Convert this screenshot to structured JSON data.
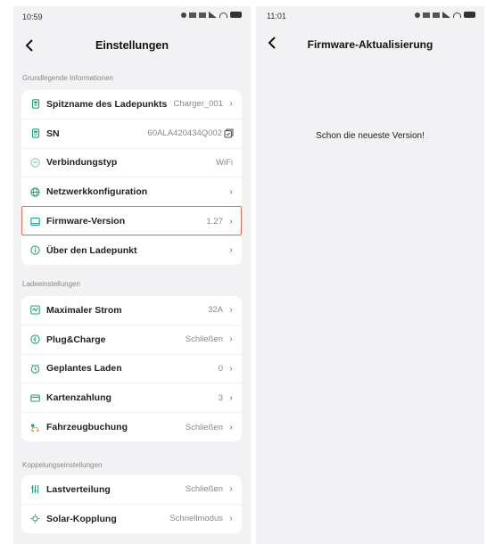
{
  "left_screen": {
    "status_time": "10:59",
    "title": "Einstellungen",
    "sections": [
      {
        "label": "Grundlegende Informationen",
        "items": [
          {
            "label": "Spitzname des Ladepunkts",
            "value": "Charger_001",
            "icon": "charger-icon",
            "control": "chevron"
          },
          {
            "label": "SN",
            "value": "60ALA420434Q002",
            "icon": "charger-icon",
            "control": "copy"
          },
          {
            "label": "Verbindungstyp",
            "value": "WiFi",
            "icon": "connection-icon",
            "control": "none"
          },
          {
            "label": "Netzwerkkonfiguration",
            "value": "",
            "icon": "globe-icon",
            "control": "chevron"
          },
          {
            "label": "Firmware-Version",
            "value": "1.27",
            "icon": "firmware-icon",
            "control": "chevron",
            "highlighted": true
          },
          {
            "label": "Über den Ladepunkt",
            "value": "",
            "icon": "info-icon",
            "control": "chevron"
          }
        ]
      },
      {
        "label": "Ladeeinstellungen",
        "items": [
          {
            "label": "Maximaler Strom",
            "value": "32A",
            "icon": "current-icon",
            "control": "chevron"
          },
          {
            "label": "Plug&Charge",
            "value": "Schließen",
            "icon": "plug-charge-icon",
            "control": "chevron"
          },
          {
            "label": "Geplantes Laden",
            "value": "0",
            "icon": "schedule-icon",
            "control": "chevron"
          },
          {
            "label": "Kartenzahlung",
            "value": "3",
            "icon": "card-icon",
            "control": "chevron"
          },
          {
            "label": "Fahrzeugbuchung",
            "value": "Schließen",
            "icon": "vehicle-booking-icon",
            "control": "chevron"
          }
        ]
      },
      {
        "label": "Koppelungseinstellungen",
        "items": [
          {
            "label": "Lastverteilung",
            "value": "Schließen",
            "icon": "load-balance-icon",
            "control": "chevron"
          },
          {
            "label": "Solar-Kopplung",
            "value": "Schnellmodus",
            "icon": "solar-icon",
            "control": "chevron"
          }
        ]
      }
    ]
  },
  "right_screen": {
    "status_time": "11:01",
    "title": "Firmware-Aktualisierung",
    "message": "Schon die neueste Version!"
  },
  "colors": {
    "accent": "#1fa67a",
    "highlight_border": "#e46e4f",
    "background": "#f2f2f4"
  }
}
